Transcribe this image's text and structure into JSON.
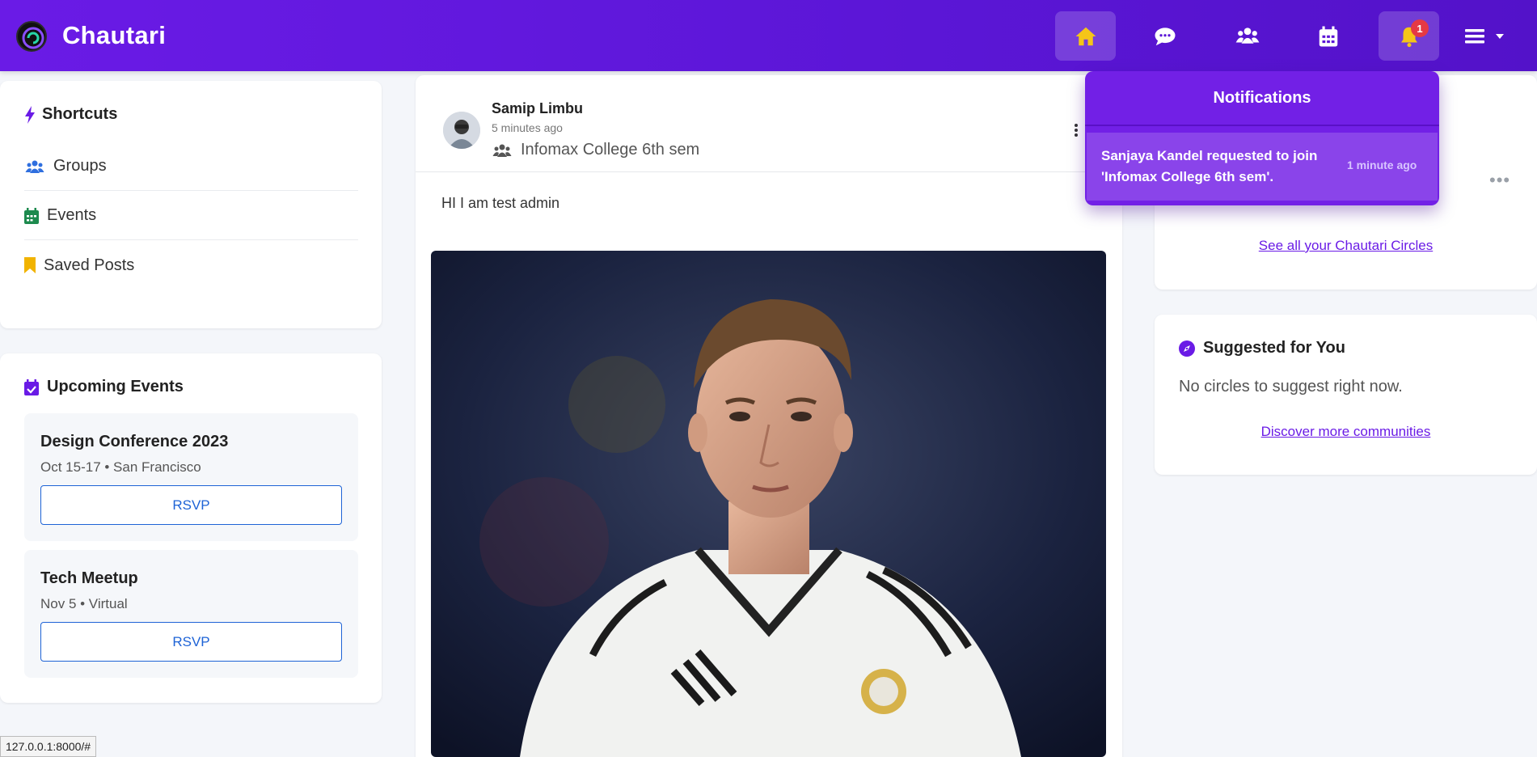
{
  "app": {
    "name": "Chautari"
  },
  "nav": {
    "items": [
      {
        "icon": "home-icon",
        "active": true
      },
      {
        "icon": "chat-icon",
        "active": false
      },
      {
        "icon": "users-icon",
        "active": false
      },
      {
        "icon": "calendar-icon",
        "active": false
      },
      {
        "icon": "bell-icon",
        "active": true
      }
    ],
    "notification_count": "1",
    "menu_icon": "hamburger-icon"
  },
  "shortcuts": {
    "title": "Shortcuts",
    "items": [
      {
        "label": "Groups",
        "icon": "users-icon",
        "color": "#2f6fdf"
      },
      {
        "label": "Events",
        "icon": "calendar-icon",
        "color": "#1d8a4e"
      },
      {
        "label": "Saved Posts",
        "icon": "bookmark-icon",
        "color": "#f1b300"
      }
    ]
  },
  "events": {
    "title": "Upcoming Events",
    "items": [
      {
        "name": "Design Conference 2023",
        "meta": "Oct 15-17 • San Francisco",
        "rsvp": "RSVP"
      },
      {
        "name": "Tech Meetup",
        "meta": "Nov 5 • Virtual",
        "rsvp": "RSVP"
      }
    ]
  },
  "post": {
    "author": "Samip Limbu",
    "time": "5 minutes ago",
    "group": "Infomax College 6th sem",
    "text": "HI I am test admin"
  },
  "circles": {
    "see_all": "See all your Chautari Circles"
  },
  "suggested": {
    "title": "Suggested for You",
    "empty": "No circles to suggest right now.",
    "discover": "Discover more communities"
  },
  "notifications": {
    "title": "Notifications",
    "items": [
      {
        "message": "Sanjaya Kandel requested to join 'Infomax College 6th sem'.",
        "time": "1 minute ago"
      }
    ]
  },
  "status_url": "127.0.0.1:8000/#",
  "colors": {
    "brand": "#6a1be6",
    "link": "#1e63d6",
    "badge": "#e53944",
    "home_icon": "#f5c518"
  }
}
